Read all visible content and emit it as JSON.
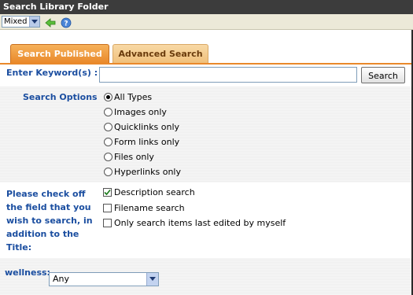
{
  "window": {
    "title": "Search Library Folder"
  },
  "toolbar": {
    "mode_value": "Mixed",
    "icons": [
      "back-arrow-icon",
      "help-icon"
    ]
  },
  "tabs": [
    {
      "label": "Search Published",
      "active": true
    },
    {
      "label": "Advanced Search",
      "active": false
    }
  ],
  "keyword": {
    "label": "Enter Keyword(s) :",
    "value": "",
    "button_label": "Search"
  },
  "search_options": {
    "label": "Search Options",
    "options": [
      {
        "label": "All Types",
        "checked": true
      },
      {
        "label": "Images only",
        "checked": false
      },
      {
        "label": "Quicklinks only",
        "checked": false
      },
      {
        "label": "Form links only",
        "checked": false
      },
      {
        "label": "Files only",
        "checked": false
      },
      {
        "label": "Hyperlinks only",
        "checked": false
      }
    ]
  },
  "fields": {
    "label": "Please check off the field that you wish to search, in addition to the Title:",
    "items": [
      {
        "label": "Description search",
        "checked": true
      },
      {
        "label": "Filename search",
        "checked": false
      },
      {
        "label": "Only search items last edited by myself",
        "checked": false
      }
    ]
  },
  "wellness": {
    "label": "wellness:",
    "value": "Any"
  },
  "colors": {
    "label_blue": "#1b4ea0",
    "tab_active": "#e9892b",
    "tab_inactive": "#f0c07c",
    "titlebar": "#3c3c3c"
  }
}
